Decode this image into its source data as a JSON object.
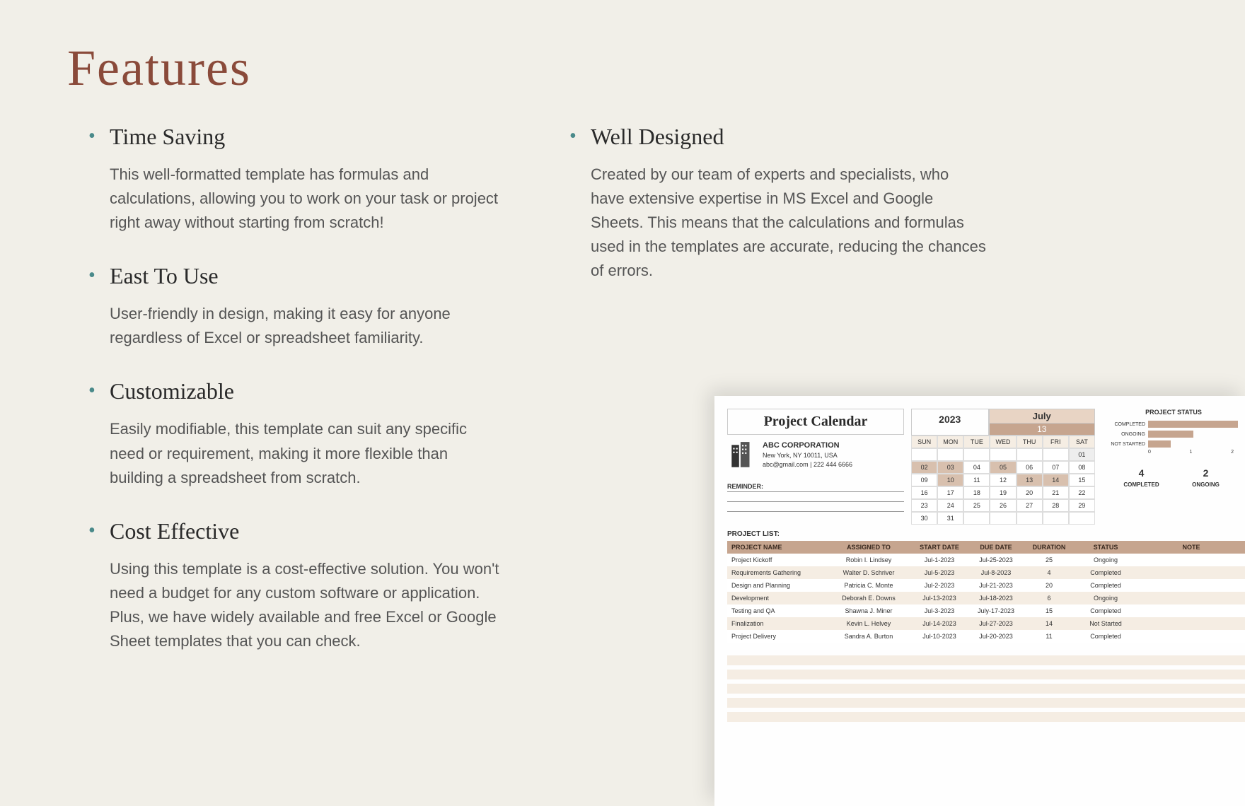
{
  "page": {
    "title": "Features"
  },
  "features": {
    "left": [
      {
        "title": "Time Saving",
        "body": "This well-formatted template has formulas and calculations, allowing you to work on your task or project right away without starting from scratch!"
      },
      {
        "title": "East To Use",
        "body": "User-friendly in design, making it easy for anyone regardless of Excel or spreadsheet familiarity."
      },
      {
        "title": "Customizable",
        "body": "Easily modifiable, this template can suit any specific need or requirement, making it more flexible than building a spreadsheet from scratch."
      },
      {
        "title": "Cost Effective",
        "body": "Using this template is a cost-effective solution. You won't need a budget for any custom software or application. Plus, we have widely available and free Excel or Google Sheet templates that you can check."
      }
    ],
    "right": [
      {
        "title": "Well Designed",
        "body": "Created by our team of  experts and specialists, who have extensive expertise in MS Excel and Google Sheets. This means that the calculations and formulas used in the templates are accurate, reducing the chances of errors."
      }
    ]
  },
  "sheet": {
    "title": "Project Calendar",
    "year": "2023",
    "month": "July",
    "current_day": "13",
    "company": {
      "name": "ABC CORPORATION",
      "address": "New York, NY 10011, USA",
      "contact": "abc@gmail.com | 222 444 6666"
    },
    "reminder_label": "REMINDER:",
    "calendar": {
      "days_header": [
        "SUN",
        "MON",
        "TUE",
        "WED",
        "THU",
        "FRI",
        "SAT"
      ],
      "rows": [
        [
          "",
          "",
          "",
          "",
          "",
          "",
          "01"
        ],
        [
          "02",
          "03",
          "04",
          "05",
          "06",
          "07",
          "08"
        ],
        [
          "09",
          "10",
          "11",
          "12",
          "13",
          "14",
          "15"
        ],
        [
          "16",
          "17",
          "18",
          "19",
          "20",
          "21",
          "22"
        ],
        [
          "23",
          "24",
          "25",
          "26",
          "27",
          "28",
          "29"
        ],
        [
          "30",
          "31",
          "",
          "",
          "",
          "",
          ""
        ]
      ],
      "highlighted": [
        "02",
        "03",
        "05",
        "10",
        "13",
        "14"
      ]
    },
    "status_chart": {
      "title": "PROJECT STATUS",
      "bars": [
        {
          "label": "COMPLETED",
          "value": 4
        },
        {
          "label": "ONGOING",
          "value": 2
        },
        {
          "label": "NOT STARTED",
          "value": 1
        }
      ],
      "axis": [
        "0",
        "1",
        "2"
      ]
    },
    "summary": [
      {
        "num": "4",
        "label": "COMPLETED"
      },
      {
        "num": "2",
        "label": "ONGOING"
      }
    ],
    "project_list_label": "PROJECT LIST:",
    "columns": [
      "PROJECT NAME",
      "ASSIGNED TO",
      "START DATE",
      "DUE DATE",
      "DURATION",
      "STATUS",
      "NOTE"
    ],
    "rows": [
      {
        "name": "Project Kickoff",
        "assigned": "Robin I. Lindsey",
        "start": "Jul-1-2023",
        "due": "Jul-25-2023",
        "duration": "25",
        "status": "Ongoing"
      },
      {
        "name": "Requirements Gathering",
        "assigned": "Walter D. Schriver",
        "start": "Jul-5-2023",
        "due": "Jul-8-2023",
        "duration": "4",
        "status": "Completed"
      },
      {
        "name": "Design and Planning",
        "assigned": "Patricia C. Monte",
        "start": "Jul-2-2023",
        "due": "Jul-21-2023",
        "duration": "20",
        "status": "Completed"
      },
      {
        "name": "Development",
        "assigned": "Deborah E. Downs",
        "start": "Jul-13-2023",
        "due": "Jul-18-2023",
        "duration": "6",
        "status": "Ongoing"
      },
      {
        "name": "Testing and QA",
        "assigned": "Shawna J. Miner",
        "start": "Jul-3-2023",
        "due": "July-17-2023",
        "duration": "15",
        "status": "Completed"
      },
      {
        "name": "Finalization",
        "assigned": "Kevin L. Helvey",
        "start": "Jul-14-2023",
        "due": "Jul-27-2023",
        "duration": "14",
        "status": "Not Started"
      },
      {
        "name": "Project Delivery",
        "assigned": "Sandra A. Burton",
        "start": "Jul-10-2023",
        "due": "Jul-20-2023",
        "duration": "11",
        "status": "Completed"
      }
    ]
  },
  "chart_data": {
    "type": "bar",
    "title": "PROJECT STATUS",
    "categories": [
      "COMPLETED",
      "ONGOING",
      "NOT STARTED"
    ],
    "values": [
      4,
      2,
      1
    ],
    "xlabel": "",
    "ylabel": "",
    "ylim": [
      0,
      4
    ]
  }
}
